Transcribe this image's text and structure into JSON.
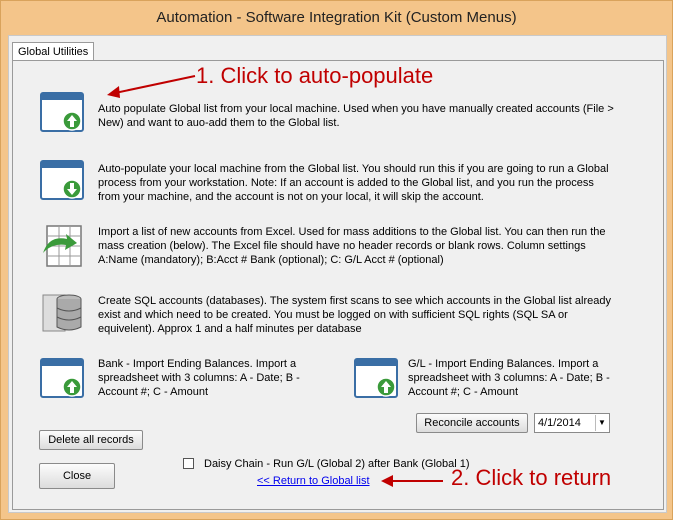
{
  "window": {
    "title": "Automation - Software Integration Kit (Custom Menus)"
  },
  "tabs": [
    {
      "label": "Global Utilities"
    }
  ],
  "annotations": {
    "step1": "1. Click to auto-populate",
    "step2": "2. Click to return",
    "color": "#c00000"
  },
  "actions": [
    {
      "icon": "window-up-arrow-icon",
      "text": "Auto populate Global list from your local machine.  Used when you have manually created accounts (File > New) and want to auo-add them to the Global list."
    },
    {
      "icon": "window-down-arrow-icon",
      "text": "Auto-populate your local machine from the Global list.  You should run this if you are going to run a Global process from your workstation. Note: If an account is added to the Global list, and you run the process from your machine, and the account is not on your local, it will skip the account."
    },
    {
      "icon": "excel-import-icon",
      "text": "Import a list of new accounts from Excel.  Used for mass additions to the Global list.  You can then run the mass creation (below).  The Excel file should have no header records or blank rows.  Column settings A:Name (mandatory); B:Acct # Bank (optional); C: G/L Acct # (optional)"
    },
    {
      "icon": "database-icon",
      "text": "Create SQL accounts (databases). The system first scans to see which accounts in the Global list already exist and which need to be created.  You must be logged on with sufficient SQL rights (SQL SA or equivelent).  Approx 1 and a half minutes per database"
    }
  ],
  "imports": {
    "bank": {
      "icon": "window-up-arrow-icon",
      "text": "Bank - Import Ending Balances.   Import a spreadsheet with 3 columns: A - Date; B - Account #; C - Amount"
    },
    "gl": {
      "icon": "window-up-arrow-icon",
      "text": "G/L - Import Ending Balances.   Import a spreadsheet with 3 columns: A - Date; B - Account #; C - Amount"
    }
  },
  "controls": {
    "reconcile_label": "Reconcile accounts",
    "date_value": "4/1/2014",
    "delete_label": "Delete all records",
    "daisy_chain_label": "Daisy Chain - Run G/L (Global 2) after Bank (Global 1)",
    "daisy_chain_checked": false,
    "close_label": "Close",
    "return_link": "<< Return to Global list"
  }
}
